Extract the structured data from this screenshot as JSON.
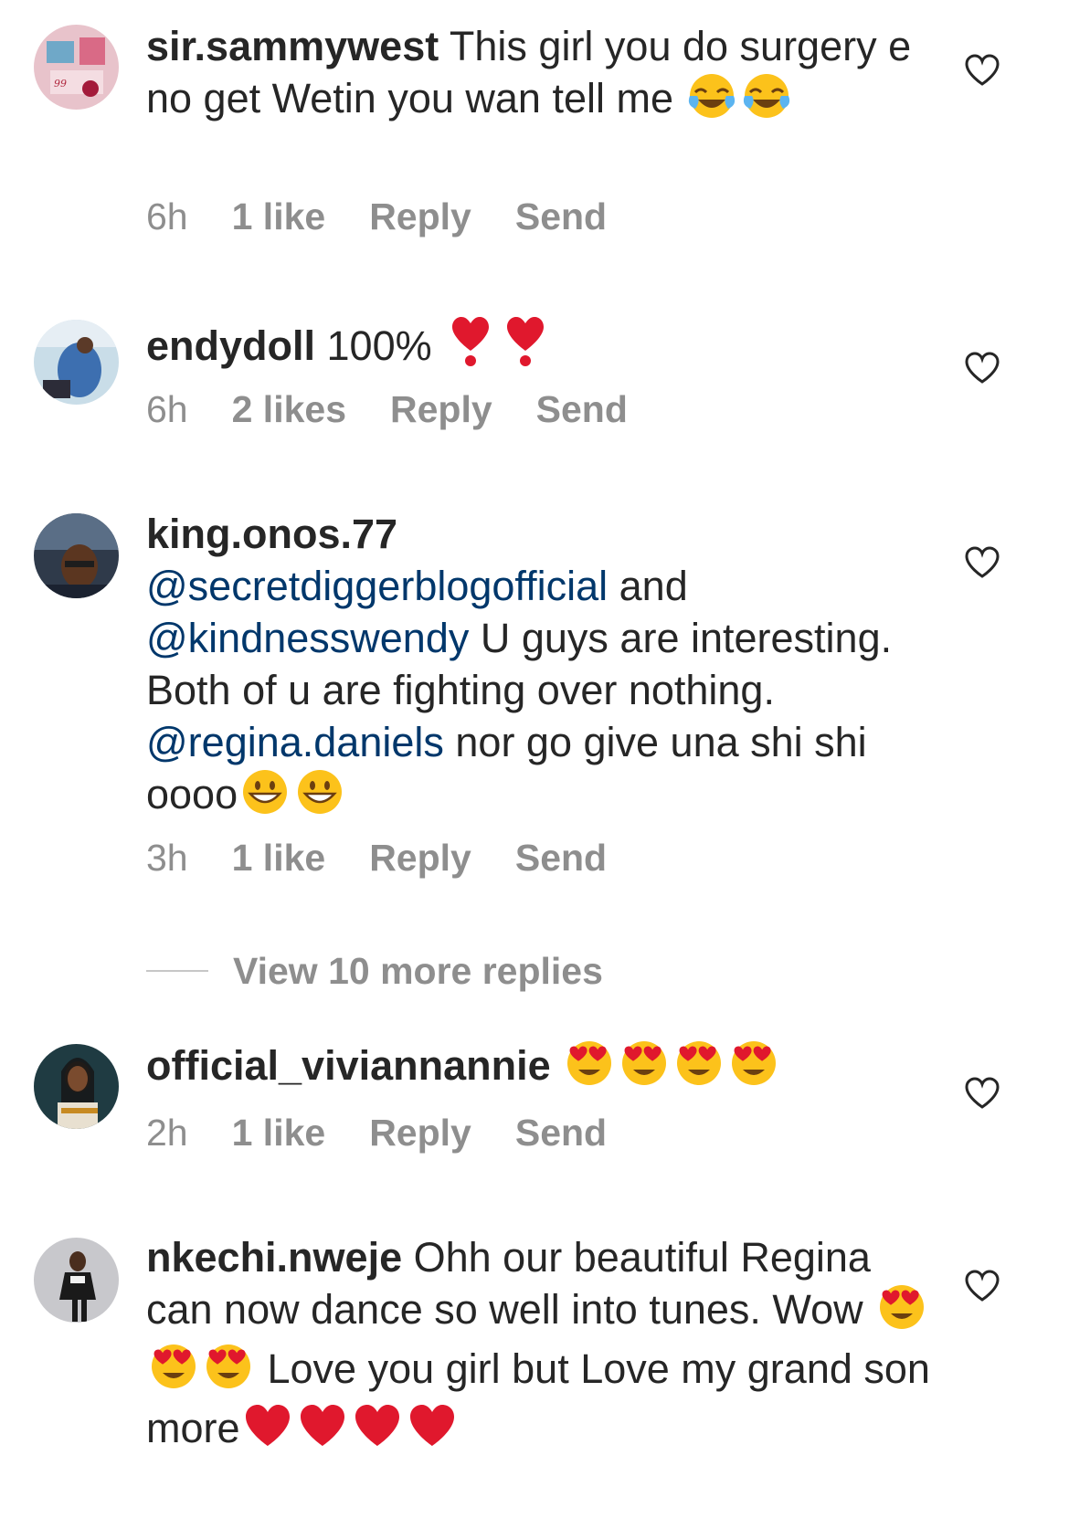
{
  "comments": [
    {
      "username": "sir.sammywest",
      "text": " This girl you do surgery e no get Wetin you wan tell me ",
      "emojis": [
        "laughing",
        "laughing"
      ],
      "time": "6h",
      "likes": "1 like",
      "reply": "Reply",
      "send": "Send"
    },
    {
      "username": "endydoll",
      "text": " 100% ",
      "emojis": [
        "exclamation-heart",
        "exclamation-heart"
      ],
      "time": "6h",
      "likes": "2 likes",
      "reply": "Reply",
      "send": "Send"
    },
    {
      "username": "king.onos.77",
      "segments": [
        {
          "type": "mention",
          "text": "@secretdiggerblogofficial"
        },
        {
          "type": "text",
          "text": " and "
        },
        {
          "type": "mention",
          "text": "@kindnesswendy"
        },
        {
          "type": "text",
          "text": " U guys are interesting. Both of u are fighting over nothing. "
        },
        {
          "type": "mention",
          "text": "@regina.daniels"
        },
        {
          "type": "text",
          "text": " nor go give una shi shi oooo"
        }
      ],
      "emojis": [
        "grinning",
        "grinning"
      ],
      "time": "3h",
      "likes": "1 like",
      "reply": "Reply",
      "send": "Send"
    },
    {
      "username": "official_viviannannie",
      "emojis": [
        "heart-eyes",
        "heart-eyes",
        "heart-eyes",
        "heart-eyes"
      ],
      "time": "2h",
      "likes": "1 like",
      "reply": "Reply",
      "send": "Send"
    },
    {
      "username": "nkechi.nweje",
      "text_part1": " Ohh our beautiful Regina can now dance so well into tunes.  Wow ",
      "text_part2": " Love you girl but Love my grand son more",
      "emojis_part1": [
        "heart-eyes",
        "heart-eyes",
        "heart-eyes"
      ],
      "emojis_part2": [
        "red-heart",
        "red-heart",
        "red-heart",
        "red-heart"
      ]
    }
  ],
  "view_more_replies": "View 10 more replies",
  "colors": {
    "text": "#262626",
    "secondary": "#8e8e8e",
    "mention": "#00376b"
  }
}
